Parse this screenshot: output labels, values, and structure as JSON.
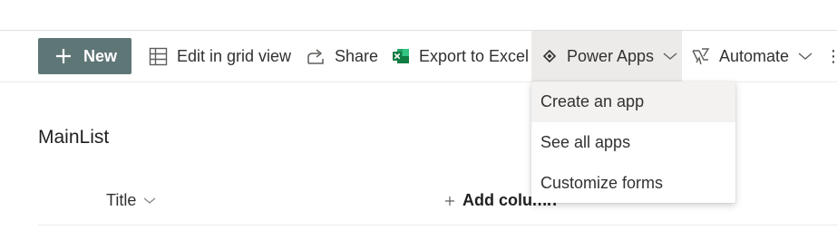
{
  "command_bar": {
    "new_label": "New",
    "edit_grid_label": "Edit in grid view",
    "share_label": "Share",
    "export_label": "Export to Excel",
    "power_apps_label": "Power Apps",
    "automate_label": "Automate",
    "more_label": "⋮"
  },
  "list": {
    "title": "MainList",
    "columns": {
      "title_label": "Title",
      "add_column_label": "Add column"
    }
  },
  "power_apps_menu": {
    "items": [
      {
        "label": "Create an app"
      },
      {
        "label": "See all apps"
      },
      {
        "label": "Customize forms"
      }
    ]
  },
  "colors": {
    "new_button_bg": "#5f7677",
    "excel_green": "#107c41",
    "active_command_bg": "#edebe9",
    "hovered_item_bg": "#f3f2f1"
  },
  "icons": {
    "new": "plus-icon",
    "edit_grid": "grid-icon",
    "share": "share-icon",
    "export": "excel-icon",
    "power_apps": "power-apps-icon",
    "automate": "flow-icon",
    "dropdown": "chevron-down-icon"
  }
}
